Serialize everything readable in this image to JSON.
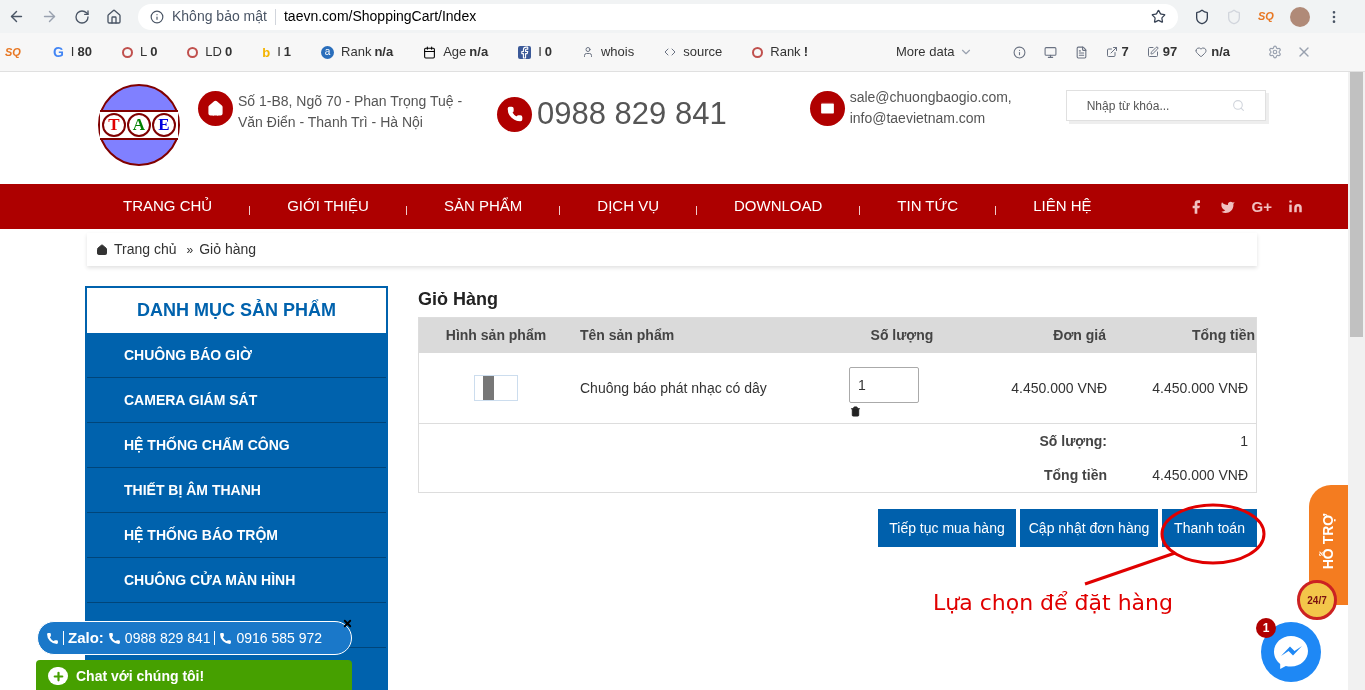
{
  "browser": {
    "security": "Không bảo mật",
    "url": "taevn.com/ShoppingCart/Index"
  },
  "browser_extension": "SQ",
  "seo_bar": {
    "logo": "SQ",
    "items": [
      {
        "kind": "google",
        "glyph": "G",
        "label": "I",
        "value": "80"
      },
      {
        "kind": "ring",
        "label": "L",
        "value": "0"
      },
      {
        "kind": "ring",
        "label": "LD",
        "value": "0"
      },
      {
        "kind": "bing",
        "glyph": "b",
        "label": "I",
        "value": "1"
      },
      {
        "kind": "alexa",
        "glyph": "a",
        "label": "Rank",
        "value": "n/a"
      },
      {
        "kind": "calendar",
        "label": "Age",
        "value": "n/a"
      },
      {
        "kind": "facebook",
        "label": "I",
        "value": "0"
      },
      {
        "kind": "user",
        "label": "whois"
      },
      {
        "kind": "code",
        "label": "source"
      },
      {
        "kind": "ring",
        "label": "Rank",
        "value": "!"
      }
    ],
    "more": "More data",
    "right_items": [
      {
        "kind": "external",
        "value": "7"
      },
      {
        "kind": "edit",
        "value": "97"
      },
      {
        "kind": "heart",
        "value": "n/a"
      }
    ]
  },
  "header": {
    "logo_letters": [
      "T",
      "A",
      "E"
    ],
    "address": "Số 1-B8, Ngõ 70 - Phan Trọng Tuệ - Văn Điển - Thanh Trì - Hà Nội",
    "phone": "0988 829 841",
    "email": "sale@chuongbaogio.com, info@taevietnam.com",
    "search": {
      "placeholder": "Nhập từ khóa..."
    }
  },
  "nav": {
    "google_plus": "G+",
    "items": [
      "TRANG CHỦ",
      "GIỚI THIỆU",
      "SẢN PHẨM",
      "DỊCH VỤ",
      "DOWNLOAD",
      "TIN TỨC",
      "LIÊN HỆ"
    ]
  },
  "breadcrumb": [
    "Trang chủ",
    "»",
    "Giỏ hàng"
  ],
  "sidebar": {
    "title": "DANH MỤC SẢN PHẨM",
    "items": [
      "CHUÔNG BÁO GIỜ",
      "CAMERA GIÁM SÁT",
      "HỆ THỐNG CHẤM CÔNG",
      "THIẾT BỊ ÂM THANH",
      "HỆ THỐNG BÁO TRỘM",
      "CHUÔNG CỬA MÀN HÌNH"
    ]
  },
  "cart": {
    "title": "Giỏ Hàng",
    "columns": [
      "Hình sản phẩm",
      "Tên sản phẩm",
      "Số lượng",
      "Đơn giá",
      "Tổng tiền"
    ],
    "rows": [
      {
        "name": "Chuông báo phát nhạc có dây",
        "quantity": "1",
        "price": "4.450.000 VNĐ",
        "total": "4.450.000 VNĐ"
      }
    ],
    "summary": [
      {
        "label": "Số lượng:",
        "value": "1"
      },
      {
        "label": "Tổng tiền",
        "value": "4.450.000 VNĐ"
      }
    ],
    "buttons": [
      "Tiếp tục mua hàng",
      "Cập nhật đơn hàng",
      "Thanh toán"
    ]
  },
  "annotation": "Lựa chọn để đặt hàng",
  "zalo": {
    "label": "Zalo:",
    "phones": [
      "0988 829 841",
      "0916 585 972"
    ]
  },
  "chat": "Chat với chúng tôi!",
  "support": {
    "label": "HỖ TRỢ",
    "hours": "24/7"
  },
  "messenger": {
    "badge": "1"
  }
}
